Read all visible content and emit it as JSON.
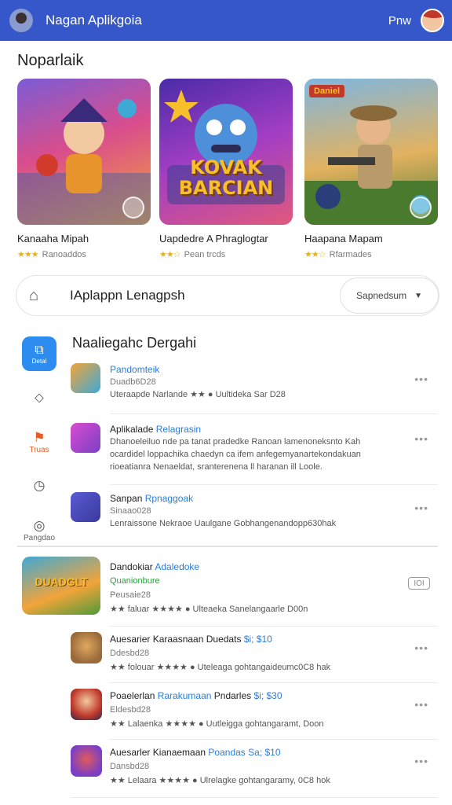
{
  "app": {
    "title": "Nagan Aplikgoia",
    "right_label": "Pnw"
  },
  "featured": {
    "title": "Noparlaik",
    "items": [
      {
        "name": "Kanaaha Mipah",
        "rating": "★★★",
        "meta": "Ranoaddos"
      },
      {
        "name": "Uapdedre A Phraglogtar",
        "rating": "★★☆",
        "meta": "Pean trcds",
        "art_title": "KOVAK BARCIAN"
      },
      {
        "name": "Haapana Mapam",
        "rating": "★★☆",
        "meta": "Rfarmades",
        "art_title": "Daniel"
      }
    ]
  },
  "search": {
    "text": "IAplappn Lenagpsh",
    "dropdown": "Sapnedsum"
  },
  "sidenav": [
    {
      "label": "Detal",
      "icon": "apps-icon",
      "active": true
    },
    {
      "label": "",
      "icon": "tag-icon"
    },
    {
      "label": "Truas",
      "icon": "trend-icon"
    },
    {
      "label": "",
      "icon": "clock-icon"
    },
    {
      "label": "Pangdao",
      "icon": "compass-icon"
    }
  ],
  "category": {
    "title": "Naaliegahc Dergahi",
    "items": [
      {
        "title_blue": "Pandomteik",
        "title_black": "",
        "line2": "Duadb6D28",
        "line3": "Uteraapde Narlande ★★ ● Uultideka Sar D28"
      },
      {
        "title_black": "Aplikalade",
        "title_blue": "Relagrasin",
        "line2": "Dhanoeleiluo nde pa tanat pradedke Ranoan lamenoneksnto Kah",
        "line3": "ocardidel loppachika chaedyn ca ifem anfegemyanartekondakuan",
        "line4": "rioeatianra Nenaeldat, sranterenena ll haranan ill Loole."
      },
      {
        "title_black": "Sanpan",
        "title_blue": "Rpnaggoak",
        "line2": "Sinaao028",
        "line3": "Lenraissone Nekraoe Uaulgane Gobhangenandopp630hak"
      }
    ]
  },
  "list": {
    "big_item": {
      "title_black": "Dandokiar",
      "title_blue": "Adaledoke",
      "line2": "Quanionbure",
      "line3": "Peusaie28",
      "rating_text": "★★ faluar ★★★★ ● Ulteaeka Sanelangaarle D00n",
      "badge": "IOI",
      "art": "DUADGLT"
    },
    "items": [
      {
        "title_black": "Auesarier Karaasnaan Duedats",
        "price": "$i; $10",
        "line2": "Ddesbd28",
        "rating_text": "★★ folouar ★★★★ ● Uteleaga gohtangaideumc0C8 hak"
      },
      {
        "title_black": "Poaelerlan",
        "title_blue": "Rarakumaan",
        "title_black2": "Pndarles",
        "price": "$i; $30",
        "line2": "Eldesbd28",
        "rating_text": "★★ Lalaenka ★★★★ ● Uutleigga gohtangaramt, Doon"
      },
      {
        "title_black": "Auesarler Kianaemaan",
        "title_blue": "Poandas",
        "price": "Sa; $10",
        "line2": "Dansbd28",
        "rating_text": "★★ Lelaara ★★★★ ● Ulrelagke gohtangaramy, 0C8 hok"
      }
    ]
  },
  "colors": {
    "topbar": "#3557c9",
    "accent_blue": "#2b7dd6",
    "star": "#e3b22a",
    "active_nav": "#2d8cf0"
  }
}
